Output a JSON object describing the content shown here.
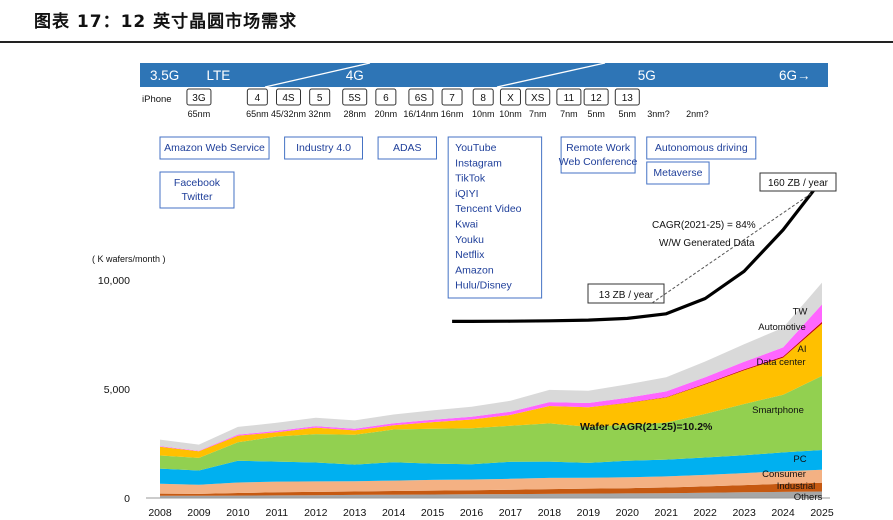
{
  "figure_title": "图表 17：12 英寸晶圆市场需求",
  "generations": [
    {
      "label": "3.5G",
      "year": 2008
    },
    {
      "label": "LTE",
      "year": 2009.5
    },
    {
      "label": "4G",
      "year": 2013
    },
    {
      "label": "5G",
      "year": 2020.5
    },
    {
      "label": "6G→",
      "year": 2024.3
    }
  ],
  "iphone": {
    "label": "iPhone",
    "models": [
      {
        "name": "3G",
        "node": "65nm",
        "year": 2009
      },
      {
        "name": "4",
        "node": "65nm",
        "year": 2010.5
      },
      {
        "name": "4S",
        "node": "45/32nm",
        "year": 2011.3
      },
      {
        "name": "5",
        "node": "32nm",
        "year": 2012.1
      },
      {
        "name": "5S",
        "node": "28nm",
        "year": 2013
      },
      {
        "name": "6",
        "node": "20nm",
        "year": 2013.8
      },
      {
        "name": "6S",
        "node": "16/14nm",
        "year": 2014.7
      },
      {
        "name": "7",
        "node": "16nm",
        "year": 2015.5
      },
      {
        "name": "8",
        "node": "10nm",
        "year": 2016.3
      },
      {
        "name": "X",
        "node": "10nm",
        "year": 2017
      },
      {
        "name": "XS",
        "node": "7nm",
        "year": 2017.7
      },
      {
        "name": "11",
        "node": "7nm",
        "year": 2018.5
      },
      {
        "name": "12",
        "node": "5nm",
        "year": 2019.2
      },
      {
        "name": "13",
        "node": "5nm",
        "year": 2020
      },
      {
        "name": "",
        "node": "3nm?",
        "year": 2020.8
      },
      {
        "name": "",
        "node": "2nm?",
        "year": 2021.8
      }
    ]
  },
  "applications": [
    {
      "lines": [
        "Amazon Web Service"
      ],
      "year_from": 2008,
      "year_to": 2010.8,
      "row": 0
    },
    {
      "lines": [
        "Industry 4.0"
      ],
      "year_from": 2011.2,
      "year_to": 2013.2,
      "row": 0
    },
    {
      "lines": [
        "ADAS"
      ],
      "year_from": 2013.6,
      "year_to": 2015.1,
      "row": 0
    },
    {
      "lines": [
        "YouTube",
        "Instagram",
        "TikTok",
        "iQIYI",
        "Tencent Video",
        "Kwai",
        "Youku",
        "Netflix",
        "Amazon",
        "Hulu/Disney"
      ],
      "year_from": 2015.4,
      "year_to": 2017.8,
      "row": 0
    },
    {
      "lines": [
        "Remote Work",
        "Web Conference"
      ],
      "year_from": 2018.3,
      "year_to": 2020.2,
      "row": 0
    },
    {
      "lines": [
        "Autonomous driving"
      ],
      "year_from": 2020.5,
      "year_to": 2023.3,
      "row": 0
    },
    {
      "lines": [
        "Facebook",
        "Twitter"
      ],
      "year_from": 2008,
      "year_to": 2009.9,
      "row": 1
    },
    {
      "lines": [
        "Metaverse"
      ],
      "year_from": 2020.5,
      "year_to": 2022.1,
      "row": 2
    }
  ],
  "annotations": {
    "zb_2025": "160 ZB / year",
    "zb_2021": "13 ZB / year",
    "cagr_data": "CAGR(2021-25) = 84%",
    "data_label": "W/W Generated Data",
    "wafer_cagr": "Wafer CAGR(21-25)=10.2%"
  },
  "chart_data": {
    "type": "area",
    "stacked": true,
    "ylabel": "( K wafers/month )",
    "ylim": [
      0,
      10000
    ],
    "yticks": [
      {
        "value": 0,
        "label": "0"
      },
      {
        "value": 5000,
        "label": "5,000"
      },
      {
        "value": 10000,
        "label": "10,000"
      }
    ],
    "x": [
      2008,
      2009,
      2010,
      2011,
      2012,
      2013,
      2014,
      2015,
      2016,
      2017,
      2018,
      2019,
      2020,
      2021,
      2022,
      2023,
      2024,
      2025
    ],
    "series": [
      {
        "name": "Others",
        "color": "#a6a6a6",
        "values": [
          100,
          100,
          110,
          120,
          130,
          140,
          150,
          160,
          170,
          180,
          190,
          200,
          210,
          220,
          240,
          260,
          280,
          300
        ]
      },
      {
        "name": "Industrial",
        "color": "#c65911",
        "values": [
          100,
          90,
          120,
          140,
          150,
          160,
          170,
          180,
          190,
          200,
          220,
          230,
          240,
          260,
          290,
          330,
          370,
          400
        ]
      },
      {
        "name": "Consumer",
        "color": "#f4b183",
        "values": [
          450,
          420,
          480,
          490,
          480,
          470,
          480,
          490,
          490,
          500,
          510,
          500,
          500,
          510,
          530,
          550,
          580,
          600
        ]
      },
      {
        "name": "PC",
        "color": "#00b0f0",
        "values": [
          700,
          650,
          1000,
          920,
          870,
          760,
          840,
          750,
          700,
          780,
          750,
          680,
          760,
          770,
          800,
          820,
          860,
          900
        ]
      },
      {
        "name": "Smartphone",
        "color": "#92d050",
        "values": [
          600,
          580,
          850,
          1150,
          1300,
          1370,
          1500,
          1600,
          1650,
          1650,
          1750,
          1650,
          1650,
          1700,
          2000,
          2350,
          2650,
          3400
        ]
      },
      {
        "name": "Data center",
        "color": "#ffc000",
        "values": [
          400,
          300,
          300,
          200,
          300,
          200,
          200,
          300,
          400,
          500,
          800,
          900,
          1000,
          1150,
          1350,
          1550,
          1700,
          2400
        ]
      },
      {
        "name": "AI",
        "color": "#c00000",
        "values": [
          0,
          0,
          0,
          0,
          0,
          0,
          0,
          0,
          0,
          0,
          0,
          0,
          10,
          20,
          30,
          40,
          50,
          80
        ]
      },
      {
        "name": "Automotive",
        "color": "#ff66ff",
        "values": [
          30,
          30,
          50,
          60,
          70,
          80,
          90,
          110,
          130,
          150,
          180,
          200,
          230,
          260,
          300,
          350,
          420,
          800
        ]
      },
      {
        "name": "TW",
        "color": "#d9d9d9",
        "values": [
          300,
          280,
          350,
          370,
          380,
          380,
          400,
          430,
          460,
          500,
          560,
          560,
          610,
          650,
          720,
          800,
          900,
          1000
        ]
      }
    ],
    "data_curve_x": [
      2015.5,
      2016,
      2017,
      2018,
      2019,
      2020,
      2021,
      2022,
      2023,
      2024,
      2025
    ],
    "data_curve_y": [
      8100,
      8100,
      8110,
      8130,
      8160,
      8240,
      8450,
      9150,
      10400,
      12300,
      14600
    ]
  }
}
